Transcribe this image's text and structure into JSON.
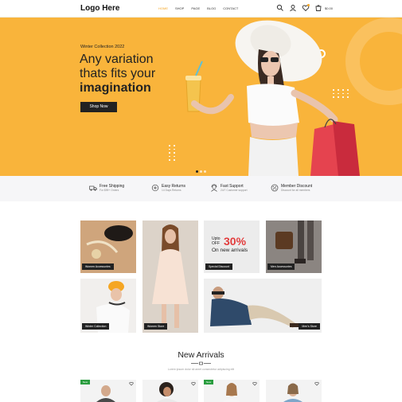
{
  "header": {
    "logo": "Logo Here",
    "nav": [
      "HOME",
      "SHOP",
      "PAGE",
      "BLOG",
      "CONTACT"
    ],
    "cart_price": "$0.00",
    "colors": {
      "accent": "#f5a623"
    }
  },
  "hero": {
    "subtitle": "Winter Collection 2022",
    "title_line1": "Any variation",
    "title_line2": "thats fits your",
    "title_line3": "imagination",
    "button": "Shop Now",
    "colors": {
      "background": "#f9b43b"
    }
  },
  "features": [
    {
      "title": "Free Shipping",
      "sub": "For $99+ Orders",
      "icon": "truck-icon"
    },
    {
      "title": "Easy Returns",
      "sub": "14 Days Returns",
      "icon": "return-icon"
    },
    {
      "title": "Fast Support",
      "sub": "24/7 Customer support",
      "icon": "support-icon"
    },
    {
      "title": "Member Discount",
      "sub": "Discount for all members",
      "icon": "discount-icon"
    }
  ],
  "categories": {
    "women_accessories": "Women Accessories",
    "special_discount": "Special Discount",
    "men_accessories": "Men Accessories",
    "winter_collection": "Winter Collection",
    "women_store": "Women Store",
    "mens_store": "Men's Store"
  },
  "promo": {
    "upto": "Upto",
    "off": "OFF",
    "percent": "30%",
    "text": "On new arrivals",
    "colors": {
      "percent": "#e23c3c"
    }
  },
  "new_arrivals": {
    "title": "New Arrivals",
    "description": "Lorem ipsum dolor sit amet consectetur adipiscing elit",
    "badge": "New",
    "colors": {
      "badge": "#2a9d3f"
    }
  }
}
